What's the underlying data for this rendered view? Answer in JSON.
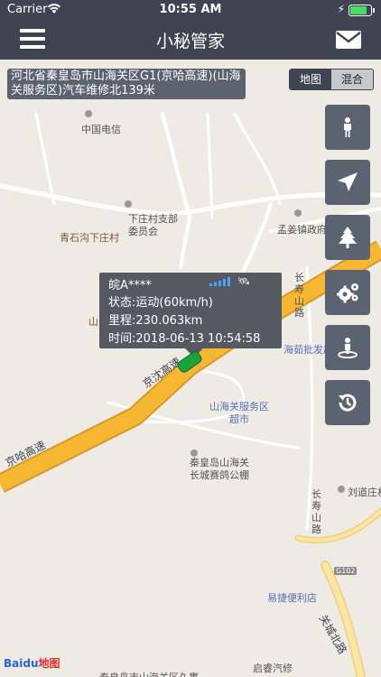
{
  "status_bar": {
    "carrier": "Carrier",
    "time": "10:55 AM",
    "battery_level": 0.85
  },
  "header": {
    "title": "小秘管家"
  },
  "address_bar": {
    "text": "河北省秦皇岛市山海关区G1(京哈高速)(山海关服务区)汽车维修北139米"
  },
  "map_type": {
    "options": [
      "地图",
      "混合"
    ],
    "selected": "地图"
  },
  "vehicle_popup": {
    "plate": "皖A****",
    "status": "状态:运动(60km/h)",
    "mileage": "里程:230.063km",
    "time": "时间:2018-06-13 10:54:58"
  },
  "side_buttons": [
    {
      "name": "person-icon"
    },
    {
      "name": "navigation-arrow-icon"
    },
    {
      "name": "tree-icon"
    },
    {
      "name": "settings-gears-icon"
    },
    {
      "name": "street-view-icon"
    },
    {
      "name": "history-playback-icon"
    }
  ],
  "map_labels": {
    "telecom": "中国电信",
    "xiazhuang_branch": "下庄村支部\n委员会",
    "qingshigou": "青石沟下庄村",
    "mengjiang": "孟姜镇政府",
    "changshou_road_1": "长\n寿\n山\n路",
    "haigu": "海茹批发超市",
    "jingshen": "京沈高速",
    "jingha": "京哈高速",
    "service_area": "山海关服务区\n超市",
    "qinhuangdao_great_wall": "秦皇岛山海关\n长城赛鸽公棚",
    "liudaozhuang": "刘道庄村",
    "changshou_road_2": "长\n寿\n山\n路",
    "g102": "G102",
    "yijie": "易捷便利店",
    "guancheng_road": "关城北路",
    "qirui": "启睿汽修",
    "bottom_partial": "秦皇岛市山海关区久寓",
    "shan_partial": "山"
  },
  "logo": {
    "brand": "Bai",
    "brand2": "du",
    "suffix": "地图"
  }
}
